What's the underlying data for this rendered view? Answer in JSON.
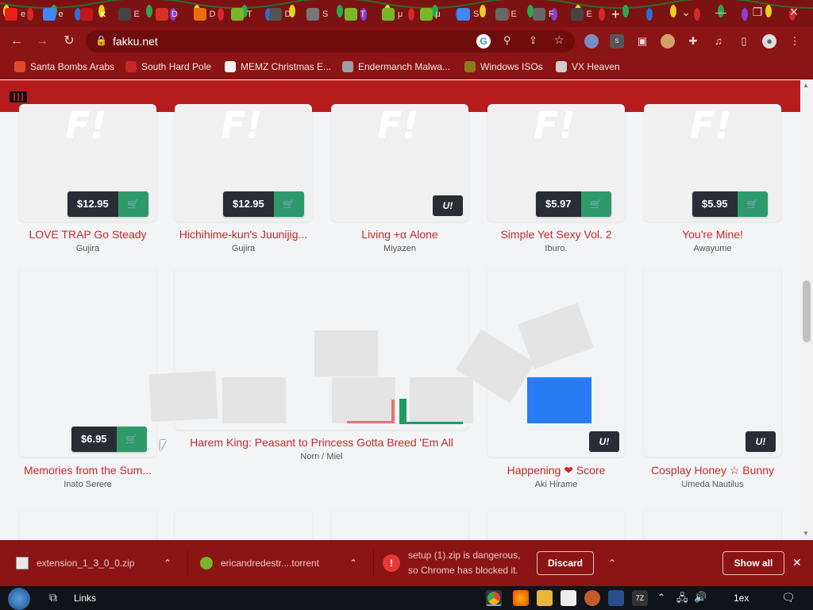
{
  "browser": {
    "tabs": [
      {
        "label": "e",
        "icon": "youtube-icon",
        "color": "#e62117"
      },
      {
        "label": "e",
        "icon": "google-icon",
        "color": "#4285f4"
      },
      {
        "label": "",
        "icon": "fakku-icon",
        "color": "#c0161c",
        "active": true
      },
      {
        "label": "E",
        "icon": "archive-icon",
        "color": "#444"
      },
      {
        "label": "D",
        "icon": "gmail-icon",
        "color": "#d93025"
      },
      {
        "label": "D",
        "icon": "x-icon",
        "color": "#e8710a"
      },
      {
        "label": "T",
        "icon": "utorrent-icon",
        "color": "#78b72a"
      },
      {
        "label": "D",
        "icon": "download-icon",
        "color": "#555"
      },
      {
        "label": "S",
        "icon": "image-icon",
        "color": "#777"
      },
      {
        "label": "T",
        "icon": "utorrent-icon",
        "color": "#78b72a"
      },
      {
        "label": "μ",
        "icon": "utorrent-icon",
        "color": "#78b72a"
      },
      {
        "label": "μ",
        "icon": "utorrent-icon",
        "color": "#78b72a"
      },
      {
        "label": "S",
        "icon": "google-icon",
        "color": "#4285f4"
      },
      {
        "label": "E",
        "icon": "puzzle-icon",
        "color": "#666"
      },
      {
        "label": "F",
        "icon": "history-icon",
        "color": "#666"
      },
      {
        "label": "E",
        "icon": "archive-icon",
        "color": "#444"
      }
    ],
    "new_tab": "+",
    "url": "fakku.net",
    "bookmarks": [
      {
        "label": "Santa Bombs Arabs",
        "color": "#e0492e"
      },
      {
        "label": "South Hard Pole",
        "color": "#c62828"
      },
      {
        "label": "MEMZ Christmas E...",
        "color": "#f2f2f2"
      },
      {
        "label": "Endermanch Malwa...",
        "color": "#9aa0a6"
      },
      {
        "label": "Windows ISOs",
        "color": "#8a7a1a"
      },
      {
        "label": "VX Heaven",
        "color": "#cfcfcf"
      }
    ]
  },
  "site": {
    "accent": "#b71c1c",
    "row1": [
      {
        "title": "LOVE TRAP Go Steady",
        "author": "Gujira",
        "price": "$12.95"
      },
      {
        "title": "Hichihime-kun's Juunijig...",
        "author": "Gujira",
        "price": "$12.95"
      },
      {
        "title": "Living +α Alone",
        "author": "Miyazen",
        "badge": "U!"
      },
      {
        "title": "Simple Yet Sexy Vol. 2",
        "author": "Iburo.",
        "price": "$5.97"
      },
      {
        "title": "You're Mine!",
        "author": "Awayume",
        "price": "$5.95"
      }
    ],
    "row2": [
      {
        "title": "Memories from the Sum...",
        "author": "Inato Serere",
        "price": "$6.95"
      },
      {
        "title": "Harem King: Peasant to Princess Gotta Breed 'Em All",
        "author": "Norn / Miel"
      },
      {
        "title": "Happening ❤ Score",
        "author": "Aki Hirame",
        "badge": "U!"
      },
      {
        "title": "Cosplay Honey ☆ Bunny",
        "author": "Umeda Nautilus",
        "badge": "U!"
      }
    ]
  },
  "downloads": [
    {
      "name": "extension_1_3_0_0.zip",
      "icon": "zip-icon"
    },
    {
      "name": "ericandredestr....torrent",
      "icon": "utorrent-icon"
    },
    {
      "name": "setup (1).zip is dangerous,\nso Chrome has blocked it.",
      "icon": "warning-icon"
    }
  ],
  "discard_label": "Discard",
  "show_all_label": "Show all",
  "taskbar": {
    "links_label": "Links",
    "clock": "1ex"
  }
}
